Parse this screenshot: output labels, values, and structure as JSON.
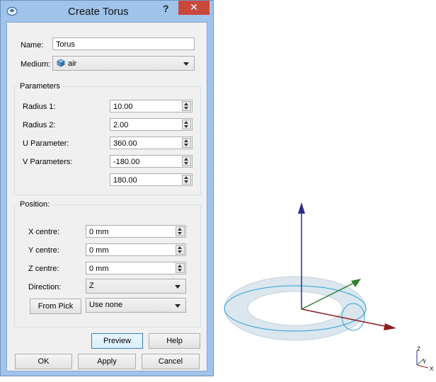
{
  "dialog": {
    "title": "Create Torus",
    "help_label": "?",
    "close_glyph": "✕",
    "name_label": "Name:",
    "name_value": "Torus",
    "medium_label": "Medium:",
    "medium_value": "air",
    "parameters": {
      "title": "Parameters",
      "radius1_label": "Radius 1:",
      "radius1_value": "10.00",
      "radius2_label": "Radius 2:",
      "radius2_value": "2.00",
      "u_label": "U Parameter:",
      "u_value": "360.00",
      "v_label": "V Parameters:",
      "v_value1": "-180.00",
      "v_value2": "180.00"
    },
    "position": {
      "title": "Position:",
      "x_label": "X centre:",
      "x_value": "0 mm",
      "y_label": "Y centre:",
      "y_value": "0 mm",
      "z_label": "Z centre:",
      "z_value": "0 mm",
      "direction_label": "Direction:",
      "direction_value": "Z",
      "from_pick_label": "From Pick",
      "pick_value": "Use none"
    },
    "buttons": {
      "preview": "Preview",
      "help": "Help",
      "ok": "OK",
      "apply": "Apply",
      "cancel": "Cancel"
    }
  },
  "viewport": {
    "axis_labels": {
      "z": "Z",
      "y": "Y",
      "x": "X"
    },
    "colors": {
      "z_axis": "#2b2b8f",
      "x_axis": "#8b1e1e",
      "y_axis": "#2f7d2f",
      "torus_fill": "#dbe6ee",
      "torus_outline": "#2aa3d8"
    }
  }
}
